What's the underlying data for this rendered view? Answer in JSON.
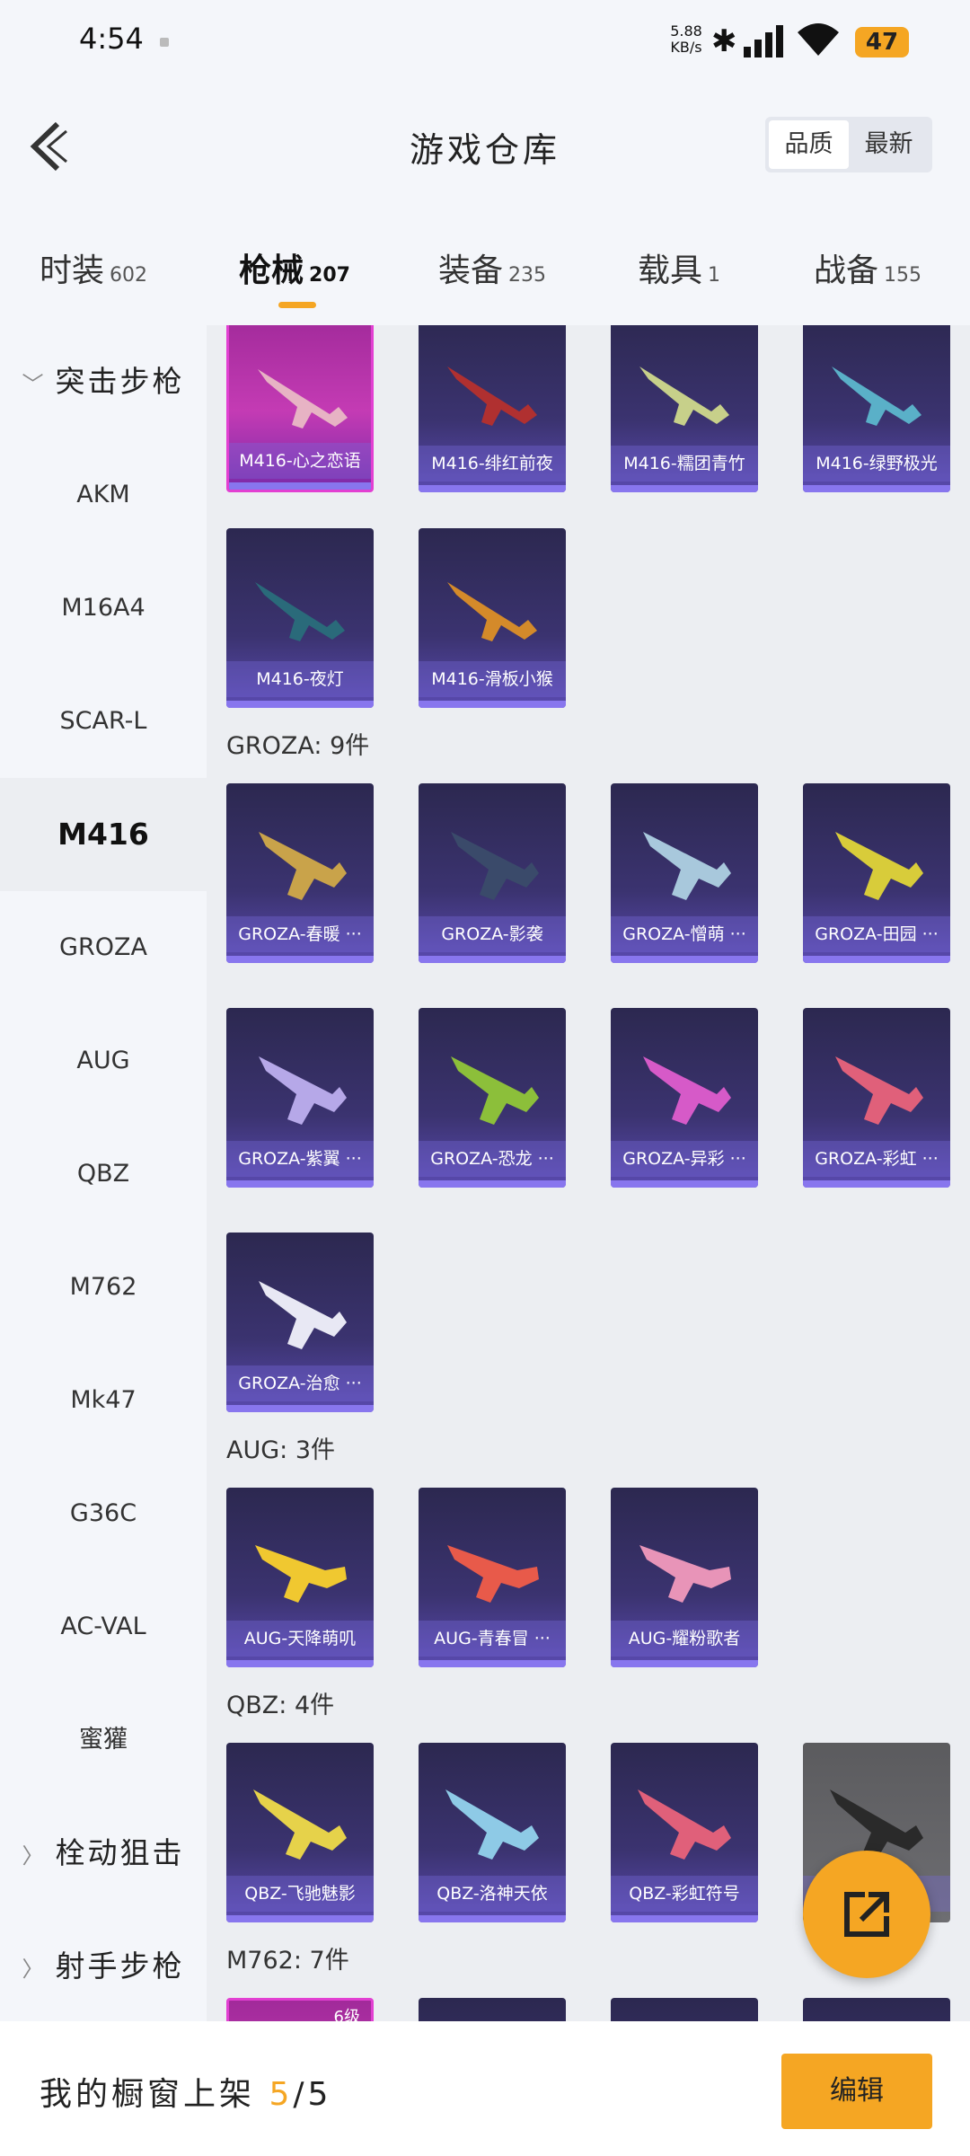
{
  "status_bar": {
    "time": "4:54",
    "net_speed": "5.88",
    "net_unit": "KB/s",
    "battery": "47"
  },
  "header": {
    "title": "游戏仓库",
    "sort": {
      "quality": "品质",
      "newest": "最新"
    }
  },
  "tabs": [
    {
      "label": "时装",
      "count": "602"
    },
    {
      "label": "枪械",
      "count": "207"
    },
    {
      "label": "装备",
      "count": "235"
    },
    {
      "label": "载具",
      "count": "1"
    },
    {
      "label": "战备",
      "count": "155"
    }
  ],
  "sidebar": {
    "group_assault": "突击步枪",
    "items": [
      "AKM",
      "M16A4",
      "SCAR-L",
      "M416",
      "GROZA",
      "AUG",
      "QBZ",
      "M762",
      "Mk47",
      "G36C",
      "AC-VAL",
      "蜜獾"
    ],
    "group_bolt": "栓动狙击",
    "group_marksman": "射手步枪"
  },
  "sections": {
    "m416": {
      "items": [
        "M416-心之恋语",
        "M416-绯红前夜",
        "M416-糯团青竹",
        "M416-绿野极光",
        "M416-夜灯",
        "M416-滑板小猴"
      ]
    },
    "groza": {
      "title": "GROZA: 9件",
      "items": [
        "GROZA-春暖 ···",
        "GROZA-影袭",
        "GROZA-憎萌 ···",
        "GROZA-田园 ···",
        "GROZA-紫翼 ···",
        "GROZA-恐龙 ···",
        "GROZA-异彩 ···",
        "GROZA-彩虹 ···",
        "GROZA-治愈 ···"
      ]
    },
    "aug": {
      "title": "AUG: 3件",
      "items": [
        "AUG-天降萌叽",
        "AUG-青春冒 ···",
        "AUG-耀粉歌者"
      ]
    },
    "qbz": {
      "title": "QBZ: 4件",
      "items": [
        "QBZ-飞驰魅影",
        "QBZ-洛神天依",
        "QBZ-彩虹符号",
        ""
      ]
    },
    "m762": {
      "title": "M762: 7件",
      "first_level": "6级"
    }
  },
  "bottom": {
    "label": "我的橱窗上架",
    "current": "5",
    "total": "/5",
    "edit": "编辑"
  },
  "colors": {
    "accent": "#f5a623",
    "card_purple": "#3b3370",
    "card_pink": "#c43bb4"
  }
}
